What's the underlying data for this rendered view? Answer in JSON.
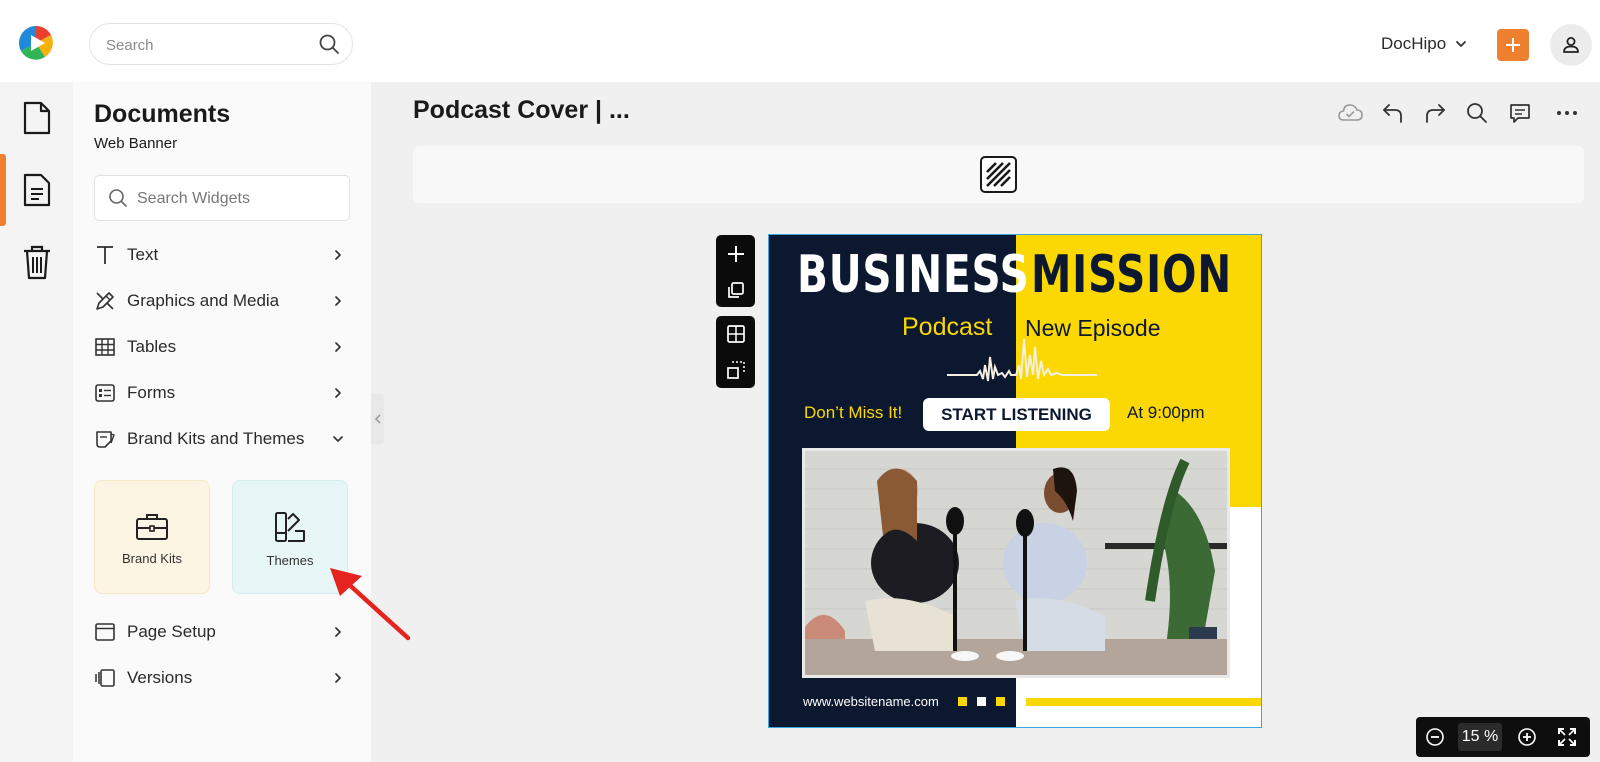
{
  "header": {
    "search_placeholder": "Search",
    "account_name": "DocHipo",
    "add_button": "+",
    "colors": {
      "accent": "#ee8030"
    }
  },
  "rail": {
    "items": [
      {
        "icon": "document-icon",
        "active": false
      },
      {
        "icon": "page-list-icon",
        "active": true
      },
      {
        "icon": "trash-icon",
        "active": false
      }
    ]
  },
  "panel": {
    "title": "Documents",
    "subtitle": "Web Banner",
    "search_placeholder": "Search Widgets",
    "items": [
      {
        "label": "Text",
        "icon": "text-icon",
        "state": "collapsed"
      },
      {
        "label": "Graphics and Media",
        "icon": "graphics-icon",
        "state": "collapsed"
      },
      {
        "label": "Tables",
        "icon": "table-icon",
        "state": "collapsed"
      },
      {
        "label": "Forms",
        "icon": "form-icon",
        "state": "collapsed"
      },
      {
        "label": "Brand Kits and Themes",
        "icon": "brand-icon",
        "state": "expanded"
      },
      {
        "label": "Page Setup",
        "icon": "page-setup-icon",
        "state": "collapsed"
      },
      {
        "label": "Versions",
        "icon": "versions-icon",
        "state": "collapsed"
      }
    ],
    "tiles": [
      {
        "label": "Brand Kits",
        "icon": "briefcase-icon"
      },
      {
        "label": "Themes",
        "icon": "themes-icon"
      }
    ]
  },
  "document": {
    "title": "Podcast Cover | ...",
    "toolbar": [
      "cloud-saved-icon",
      "undo-icon",
      "redo-icon",
      "search-icon",
      "comment-icon",
      "more-icon"
    ]
  },
  "design": {
    "headline_left": "BUSINESS",
    "headline_right": "MISSION",
    "podcast": "Podcast",
    "episode": "New Episode",
    "dont_miss": "Don’t Miss It!",
    "cta": "START LISTENING",
    "time": "At 9:00pm",
    "website": "www.websitename.com",
    "colors": {
      "navy": "#0b1830",
      "yellow": "#fbd801"
    }
  },
  "zoom": {
    "value": "15",
    "unit": "%"
  }
}
